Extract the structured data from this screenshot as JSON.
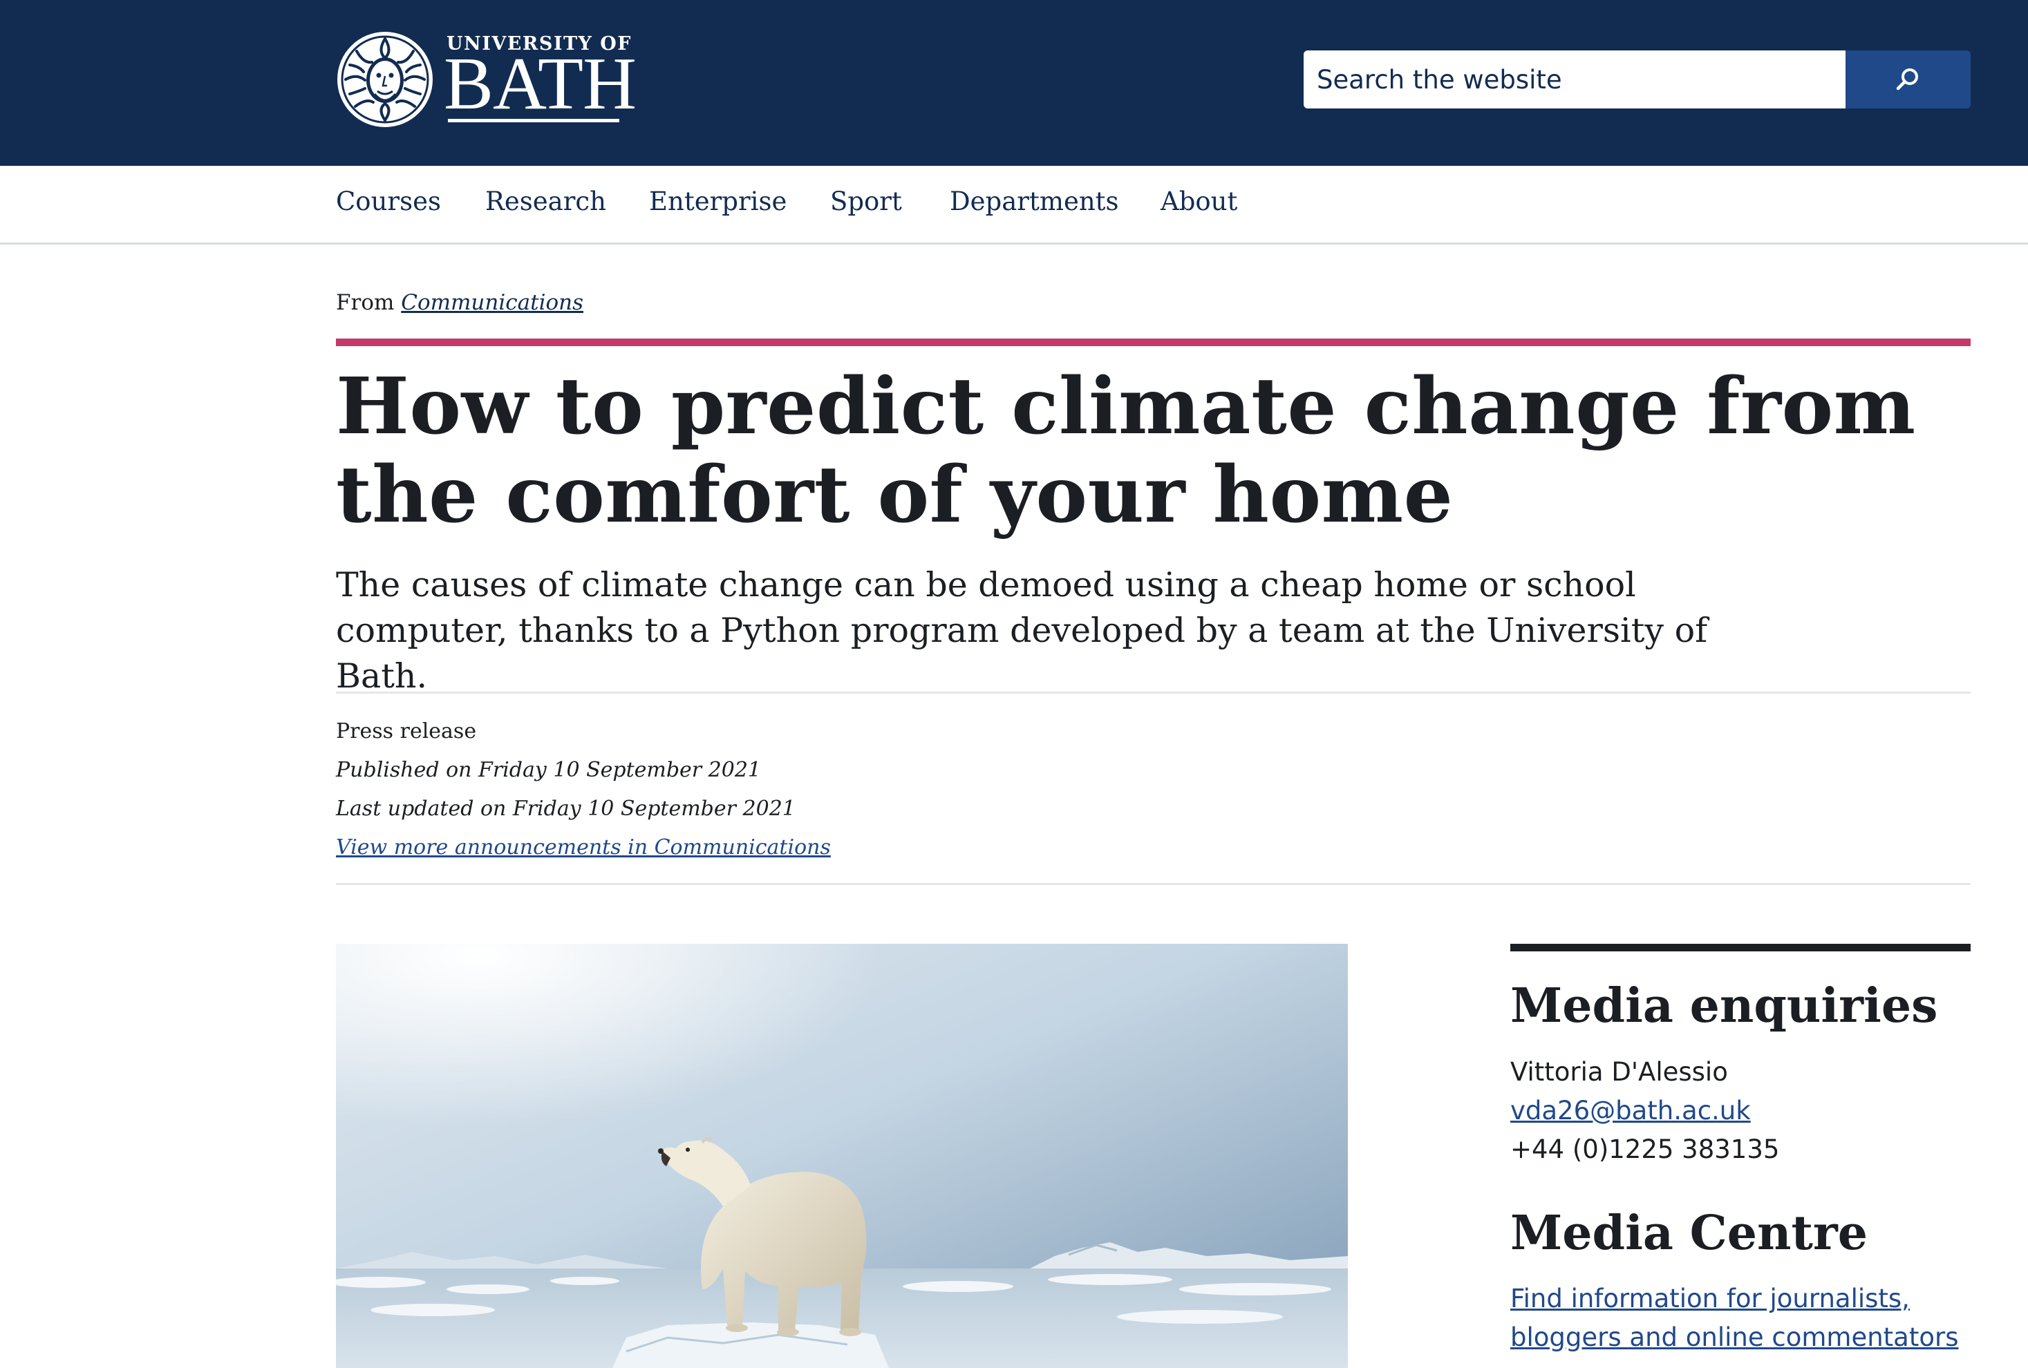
{
  "header": {
    "logo_small": "UNIVERSITY OF",
    "logo_big": "BATH",
    "search_placeholder": "Search the website",
    "search_icon": "search-icon",
    "colors": {
      "masthead": "#122c51",
      "search_button": "#20498a"
    }
  },
  "nav": {
    "items": [
      {
        "label": "Courses"
      },
      {
        "label": "Research"
      },
      {
        "label": "Enterprise"
      },
      {
        "label": "Sport"
      },
      {
        "label": "Departments"
      },
      {
        "label": "About"
      }
    ]
  },
  "breadcrumb": {
    "prefix": "From",
    "link": "Communications"
  },
  "article": {
    "title": "How to predict climate change from the comfort of your home",
    "standfirst": "The causes of climate change can be demoed using a cheap home or school computer, thanks to a Python program developed by a team at the University of Bath.",
    "type": "Press release",
    "published": "Published on Friday 10 September 2021",
    "updated": "Last updated on Friday 10 September 2021",
    "more_link": "View more announcements in Communications",
    "accent_color": "#c33a6b"
  },
  "sidebar": {
    "media_enquiries": {
      "heading": "Media enquiries",
      "name": "Vittoria D'Alessio",
      "email": "vda26@bath.ac.uk",
      "phone": "+44 (0)1225 383135"
    },
    "media_centre": {
      "heading": "Media Centre",
      "link_line1": "Find information for journalists,",
      "link_line2": "bloggers and online commentators"
    }
  }
}
